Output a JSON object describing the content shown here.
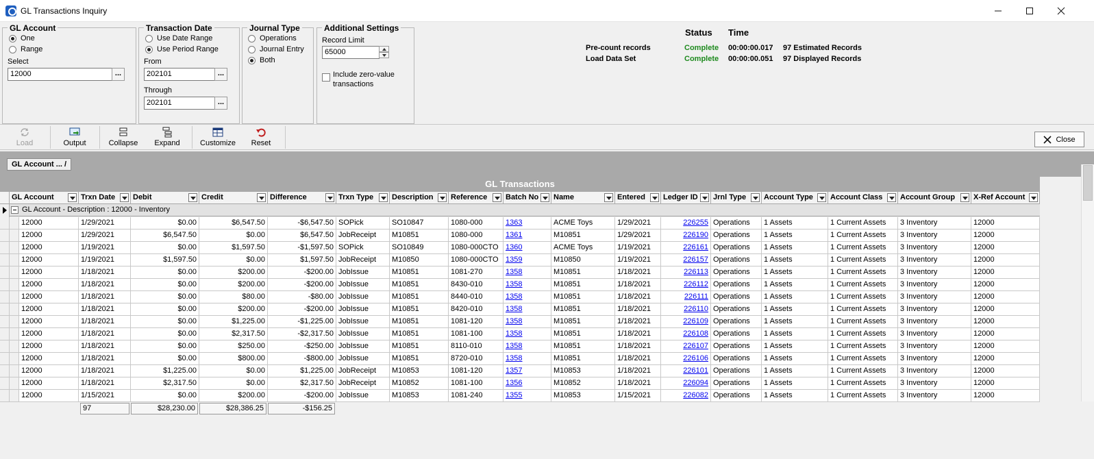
{
  "window": {
    "title": "GL Transactions Inquiry"
  },
  "gl_account": {
    "group_label": "GL Account",
    "opt_one": "One",
    "opt_range": "Range",
    "select_label": "Select",
    "select_value": "12000"
  },
  "trxn_date": {
    "group_label": "Transaction Date",
    "opt_date_range": "Use Date Range",
    "opt_period_range": "Use Period Range",
    "from_label": "From",
    "from_value": "202101",
    "through_label": "Through",
    "through_value": "202101"
  },
  "journal_type": {
    "group_label": "Journal Type",
    "opt_operations": "Operations",
    "opt_journal_entry": "Journal Entry",
    "opt_both": "Both"
  },
  "additional": {
    "group_label": "Additional Settings",
    "record_limit_label": "Record Limit",
    "record_limit_value": "65000",
    "zero_value_line1": "Include zero-value",
    "zero_value_line2": "transactions"
  },
  "status": {
    "status_header": "Status",
    "time_header": "Time",
    "rows": [
      {
        "label": "Pre-count records",
        "status": "Complete",
        "time": "00:00:00.017",
        "info": "97 Estimated Records"
      },
      {
        "label": "Load Data Set",
        "status": "Complete",
        "time": "00:00:00.051",
        "info": "97 Displayed Records"
      }
    ]
  },
  "toolbar": {
    "load": "Load",
    "output": "Output",
    "collapse": "Collapse",
    "expand": "Expand",
    "customize": "Customize",
    "reset": "Reset",
    "close": "Close"
  },
  "grouping": {
    "chip": "GL Account ...  /"
  },
  "grid": {
    "caption": "GL Transactions",
    "group_row": "GL Account - Description : 12000 - Inventory",
    "columns": [
      "GL Account",
      "Trxn Date",
      "Debit",
      "Credit",
      "Difference",
      "Trxn Type",
      "Description",
      "Reference",
      "Batch No",
      "Name",
      "Entered",
      "Ledger ID",
      "Jrnl Type",
      "Account Type",
      "Account Class",
      "Account Group",
      "X-Ref Account"
    ],
    "rows": [
      [
        "12000",
        "1/29/2021",
        "$0.00",
        "$6,547.50",
        "-$6,547.50",
        "SOPick",
        "SO10847",
        "1080-000",
        "1363",
        "ACME Toys",
        "1/29/2021",
        "226255",
        "Operations",
        "1  Assets",
        "1  Current Assets",
        "3  Inventory",
        "12000"
      ],
      [
        "12000",
        "1/29/2021",
        "$6,547.50",
        "$0.00",
        "$6,547.50",
        "JobReceipt",
        "M10851",
        "1080-000",
        "1361",
        "M10851",
        "1/29/2021",
        "226190",
        "Operations",
        "1  Assets",
        "1  Current Assets",
        "3  Inventory",
        "12000"
      ],
      [
        "12000",
        "1/19/2021",
        "$0.00",
        "$1,597.50",
        "-$1,597.50",
        "SOPick",
        "SO10849",
        "1080-000CTO",
        "1360",
        "ACME Toys",
        "1/19/2021",
        "226161",
        "Operations",
        "1  Assets",
        "1  Current Assets",
        "3  Inventory",
        "12000"
      ],
      [
        "12000",
        "1/19/2021",
        "$1,597.50",
        "$0.00",
        "$1,597.50",
        "JobReceipt",
        "M10850",
        "1080-000CTO",
        "1359",
        "M10850",
        "1/19/2021",
        "226157",
        "Operations",
        "1  Assets",
        "1  Current Assets",
        "3  Inventory",
        "12000"
      ],
      [
        "12000",
        "1/18/2021",
        "$0.00",
        "$200.00",
        "-$200.00",
        "JobIssue",
        "M10851",
        "1081-270",
        "1358",
        "M10851",
        "1/18/2021",
        "226113",
        "Operations",
        "1  Assets",
        "1  Current Assets",
        "3  Inventory",
        "12000"
      ],
      [
        "12000",
        "1/18/2021",
        "$0.00",
        "$200.00",
        "-$200.00",
        "JobIssue",
        "M10851",
        "8430-010",
        "1358",
        "M10851",
        "1/18/2021",
        "226112",
        "Operations",
        "1  Assets",
        "1  Current Assets",
        "3  Inventory",
        "12000"
      ],
      [
        "12000",
        "1/18/2021",
        "$0.00",
        "$80.00",
        "-$80.00",
        "JobIssue",
        "M10851",
        "8440-010",
        "1358",
        "M10851",
        "1/18/2021",
        "226111",
        "Operations",
        "1  Assets",
        "1  Current Assets",
        "3  Inventory",
        "12000"
      ],
      [
        "12000",
        "1/18/2021",
        "$0.00",
        "$200.00",
        "-$200.00",
        "JobIssue",
        "M10851",
        "8420-010",
        "1358",
        "M10851",
        "1/18/2021",
        "226110",
        "Operations",
        "1  Assets",
        "1  Current Assets",
        "3  Inventory",
        "12000"
      ],
      [
        "12000",
        "1/18/2021",
        "$0.00",
        "$1,225.00",
        "-$1,225.00",
        "JobIssue",
        "M10851",
        "1081-120",
        "1358",
        "M10851",
        "1/18/2021",
        "226109",
        "Operations",
        "1  Assets",
        "1  Current Assets",
        "3  Inventory",
        "12000"
      ],
      [
        "12000",
        "1/18/2021",
        "$0.00",
        "$2,317.50",
        "-$2,317.50",
        "JobIssue",
        "M10851",
        "1081-100",
        "1358",
        "M10851",
        "1/18/2021",
        "226108",
        "Operations",
        "1  Assets",
        "1  Current Assets",
        "3  Inventory",
        "12000"
      ],
      [
        "12000",
        "1/18/2021",
        "$0.00",
        "$250.00",
        "-$250.00",
        "JobIssue",
        "M10851",
        "8110-010",
        "1358",
        "M10851",
        "1/18/2021",
        "226107",
        "Operations",
        "1  Assets",
        "1  Current Assets",
        "3  Inventory",
        "12000"
      ],
      [
        "12000",
        "1/18/2021",
        "$0.00",
        "$800.00",
        "-$800.00",
        "JobIssue",
        "M10851",
        "8720-010",
        "1358",
        "M10851",
        "1/18/2021",
        "226106",
        "Operations",
        "1  Assets",
        "1  Current Assets",
        "3  Inventory",
        "12000"
      ],
      [
        "12000",
        "1/18/2021",
        "$1,225.00",
        "$0.00",
        "$1,225.00",
        "JobReceipt",
        "M10853",
        "1081-120",
        "1357",
        "M10853",
        "1/18/2021",
        "226101",
        "Operations",
        "1  Assets",
        "1  Current Assets",
        "3  Inventory",
        "12000"
      ],
      [
        "12000",
        "1/18/2021",
        "$2,317.50",
        "$0.00",
        "$2,317.50",
        "JobReceipt",
        "M10852",
        "1081-100",
        "1356",
        "M10852",
        "1/18/2021",
        "226094",
        "Operations",
        "1  Assets",
        "1  Current Assets",
        "3  Inventory",
        "12000"
      ],
      [
        "12000",
        "1/15/2021",
        "$0.00",
        "$200.00",
        "-$200.00",
        "JobIssue",
        "M10853",
        "1081-240",
        "1355",
        "M10853",
        "1/15/2021",
        "226082",
        "Operations",
        "1  Assets",
        "1  Current Assets",
        "3  Inventory",
        "12000"
      ]
    ],
    "footer": {
      "count": "97",
      "debit": "$28,230.00",
      "credit": "$28,386.25",
      "difference": "-$156.25"
    }
  },
  "colors": {
    "complete": "#1e8a1e",
    "link": "#0000ee",
    "group_bar": "#a9a9a9"
  }
}
